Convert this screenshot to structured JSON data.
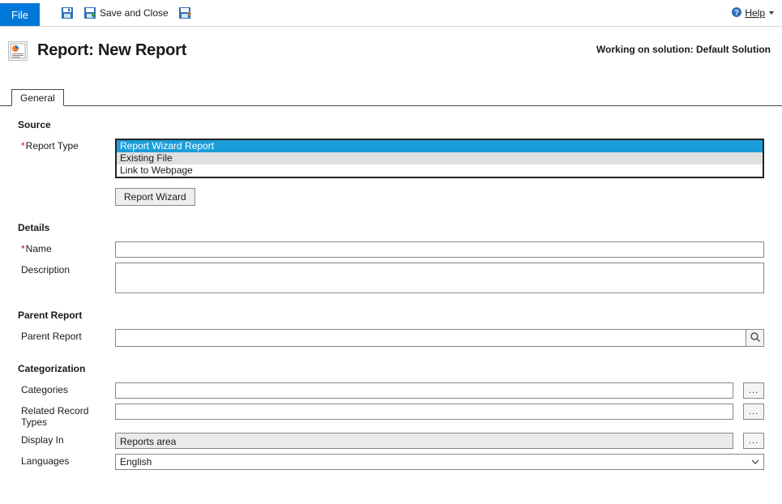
{
  "toolbar": {
    "file_label": "File",
    "save_and_close_label": "Save and Close",
    "help_label": "Help"
  },
  "header": {
    "title": "Report: New Report",
    "solution_label": "Working on solution: Default Solution"
  },
  "tabs": {
    "general": "General"
  },
  "source": {
    "heading": "Source",
    "report_type_label": "Report Type",
    "options": [
      "Report Wizard Report",
      "Existing File",
      "Link to Webpage"
    ],
    "selected_index": 0,
    "button_label": "Report Wizard"
  },
  "details": {
    "heading": "Details",
    "name_label": "Name",
    "name_value": "",
    "description_label": "Description",
    "description_value": ""
  },
  "parent": {
    "heading": "Parent Report",
    "label": "Parent Report",
    "value": ""
  },
  "categorization": {
    "heading": "Categorization",
    "categories_label": "Categories",
    "categories_value": "",
    "related_label": "Related Record Types",
    "related_value": "",
    "display_in_label": "Display In",
    "display_in_value": "Reports area",
    "languages_label": "Languages",
    "languages_value": "English"
  }
}
